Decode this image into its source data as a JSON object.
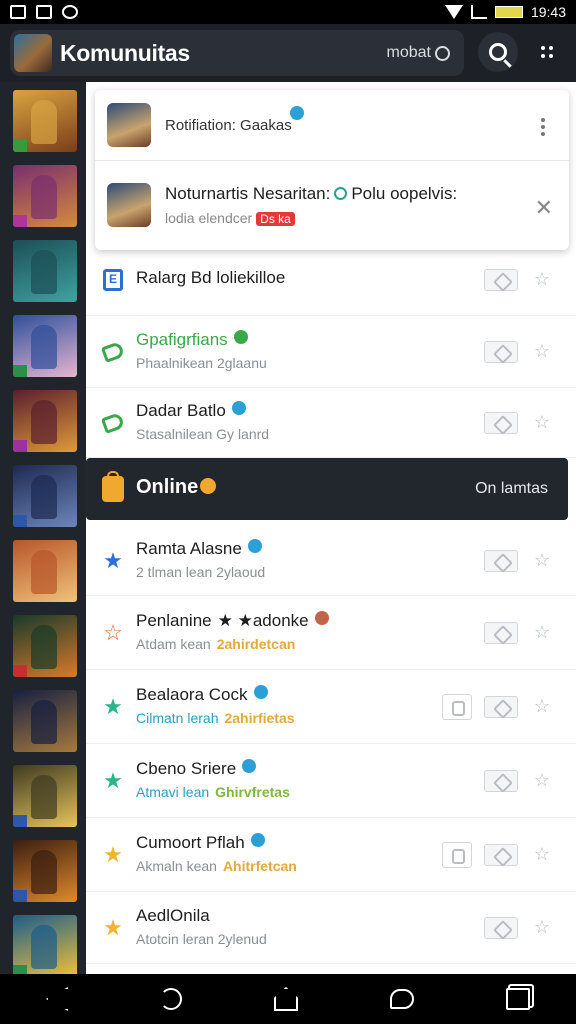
{
  "statusbar": {
    "time": "19:43"
  },
  "appbar": {
    "title": "Komunuitas",
    "mode_label": "mobat"
  },
  "rail": {
    "thumbs": [
      {
        "caption": "",
        "colors": [
          "#d9a441",
          "#7a3d1b"
        ],
        "tag": "#3a9a3a"
      },
      {
        "caption": "",
        "colors": [
          "#7a2e6e",
          "#d48b3c"
        ],
        "tag": "#b0359a"
      },
      {
        "caption": "",
        "colors": [
          "#1c4e57",
          "#3fa3a0"
        ],
        "tag": ""
      },
      {
        "caption": "",
        "colors": [
          "#2e4f9a",
          "#e5b5d0"
        ],
        "tag": "#2b8f4a"
      },
      {
        "caption": "",
        "colors": [
          "#5a1f2e",
          "#e09a3a"
        ],
        "tag": "#9b32a0"
      },
      {
        "caption": "",
        "colors": [
          "#1d2a52",
          "#6d86b8"
        ],
        "tag": "#2d57a8"
      },
      {
        "caption": "",
        "colors": [
          "#b8562a",
          "#f0c27a"
        ],
        "tag": ""
      },
      {
        "caption": "",
        "colors": [
          "#183a2a",
          "#d97a2a"
        ],
        "tag": "#c33030"
      },
      {
        "caption": "",
        "colors": [
          "#152040",
          "#a77a3e"
        ],
        "tag": ""
      },
      {
        "caption": "",
        "colors": [
          "#3e3a22",
          "#e7c45a"
        ],
        "tag": "#2d57a8"
      },
      {
        "caption": "",
        "colors": [
          "#3b1e10",
          "#e08a2c"
        ],
        "tag": "#2d57a8"
      },
      {
        "caption": "",
        "colors": [
          "#1b5d8a",
          "#f0c03a"
        ],
        "tag": "#2b8f4a"
      }
    ]
  },
  "notifications": [
    {
      "title": "Rotifiation: Gaakas"
    },
    {
      "title": "Noturnartis Nesaritan:",
      "extra": "Polu oopelvis:",
      "subtitle": "lodia elendcer",
      "badge": "Ds ka"
    }
  ],
  "list": [
    {
      "title": "Ralarg Bd loliekilloe",
      "subtitle": "",
      "highlight": "",
      "icon_color": "#2d6fd6",
      "icon": "E",
      "dot": ""
    },
    {
      "title": "Gpafigrfians",
      "subtitle": "Phaalnikean 2glaanu",
      "highlight": "",
      "icon_color": "#3aa84a",
      "icon": "tag",
      "dot": "#3aa84a",
      "title_color": "#3aa84a"
    },
    {
      "title": "Dadar Batlo",
      "subtitle": "Stasalnilean Gy lanrd",
      "highlight": "",
      "icon_color": "#3aa84a",
      "icon": "tag",
      "dot": "#2ba0d6"
    },
    {
      "title": "Ramta Alasne",
      "subtitle": "2 tlman lean 2ylaoud",
      "highlight": "",
      "icon_color": "#2d6fd6",
      "icon": "★",
      "dot": "#2ba0d6"
    },
    {
      "title": "Penlanine",
      "title_extra": "★ ★adonke",
      "subtitle": "Atdam kean",
      "highlight": "2ahirdetcan",
      "icon_color": "#e06a3a",
      "icon": "☆",
      "dot": "#c0654a"
    },
    {
      "title": "Bealaora Cock",
      "subtitle": "Cilmatn lerah",
      "highlight": "2ahirfietas",
      "icon_color": "#2ab48a",
      "icon": "★",
      "dot": "#2ba0d6"
    },
    {
      "title": "Cbeno Sriere",
      "subtitle": "Atmavi lean",
      "highlight": "Ghirvfretas",
      "icon_color": "#2ab48a",
      "icon": "★",
      "dot": "#2ba0d6"
    },
    {
      "title": "Cumoort Pflah",
      "subtitle": "Akmaln kean",
      "highlight": "Ahitrfetcan",
      "icon_color": "#f0b42e",
      "icon": "★",
      "dot": "#2ba0d6"
    },
    {
      "title": "AedlOnila",
      "subtitle": "Atotcin leran 2ylenud",
      "highlight": "",
      "icon_color": "#f0b42e",
      "icon": "★",
      "dot": ""
    }
  ],
  "online": {
    "title": "Online",
    "right_label": "On lamtas"
  }
}
